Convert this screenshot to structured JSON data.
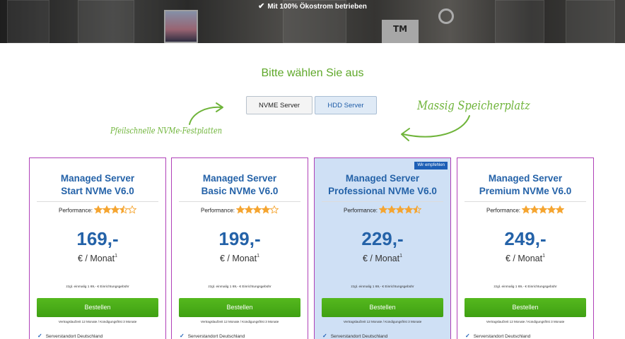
{
  "hero": {
    "text": "Mit 100% Ökostrom betrieben",
    "icon": "check-icon"
  },
  "subtitle": "Bitte wählen Sie aus",
  "toggles": {
    "nvme": "NVME Server",
    "hdd": "HDD Server"
  },
  "annotations": {
    "left": "Pfeilschnelle NVMe-Festplatten",
    "right": "Massig Speicherplatz"
  },
  "colors": {
    "accent_green": "#5fa82a",
    "title_blue": "#2462a8",
    "button_green": "#4cae18",
    "featured_bg": "#cfe0f5",
    "card_border": "#b040b8"
  },
  "cards": [
    {
      "title1": "Managed Server",
      "title2": "Start NVMe V6.0",
      "perf_label": "Performance:",
      "rating": 3.5,
      "price": "169,-",
      "unit": "€ / Monat",
      "unit_sup": "1",
      "setup": "zzgl. einmalig 1 69,- € Einrichtungsgebühr",
      "button": "Bestellen",
      "terms": "Vertragslaufzeit 12 Monate / Kündigungsfrist 3 Monate",
      "feature": "Serverstandort Deutschland"
    },
    {
      "title1": "Managed Server",
      "title2": "Basic NVMe V6.0",
      "perf_label": "Performance:",
      "rating": 4,
      "price": "199,-",
      "unit": "€ / Monat",
      "unit_sup": "1",
      "setup": "zzgl. einmalig 1 69,- € Einrichtungsgebühr",
      "button": "Bestellen",
      "terms": "Vertragslaufzeit 12 Monate / Kündigungsfrist 3 Monate",
      "feature": "Serverstandort Deutschland"
    },
    {
      "badge": "Wir empfehlen",
      "title1": "Managed Server",
      "title2": "Professional NVMe V6.0",
      "perf_label": "Performance:",
      "rating": 4.5,
      "price": "229,-",
      "unit": "€ / Monat",
      "unit_sup": "1",
      "setup": "zzgl. einmalig 1 69,- € Einrichtungsgebühr",
      "button": "Bestellen",
      "terms": "Vertragslaufzeit 12 Monate / Kündigungsfrist 3 Monate",
      "feature": "Serverstandort Deutschland"
    },
    {
      "title1": "Managed Server",
      "title2": "Premium NVMe V6.0",
      "perf_label": "Performance:",
      "rating": 5,
      "price": "249,-",
      "unit": "€ / Monat",
      "unit_sup": "1",
      "setup": "zzgl. einmalig 1 69,- € Einrichtungsgebühr",
      "button": "Bestellen",
      "terms": "Vertragslaufzeit 12 Monate / Kündigungsfrist 3 Monate",
      "feature": "Serverstandort Deutschland"
    }
  ]
}
